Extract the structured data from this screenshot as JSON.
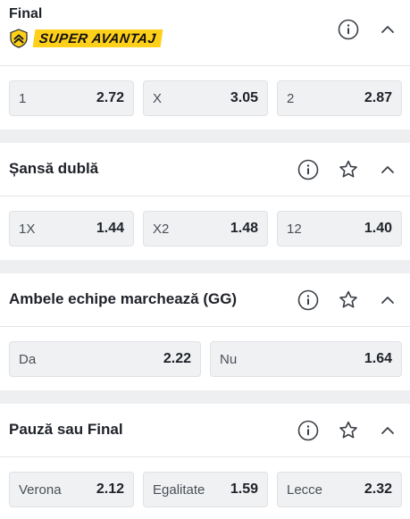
{
  "markets": [
    {
      "title": "Final",
      "badge": "SUPER AVANTAJ",
      "collapse_icon": "chevron-up-icon",
      "info_icon": "info-icon",
      "outcomes": [
        {
          "label": "1",
          "odds": "2.72"
        },
        {
          "label": "X",
          "odds": "3.05"
        },
        {
          "label": "2",
          "odds": "2.87"
        }
      ]
    },
    {
      "title": "Șansă dublă",
      "collapse_icon": "chevron-up-icon",
      "info_icon": "info-icon",
      "favorite_icon": "star-icon",
      "outcomes": [
        {
          "label": "1X",
          "odds": "1.44"
        },
        {
          "label": "X2",
          "odds": "1.48"
        },
        {
          "label": "12",
          "odds": "1.40"
        }
      ]
    },
    {
      "title": "Ambele echipe marchează (GG)",
      "collapse_icon": "chevron-up-icon",
      "info_icon": "info-icon",
      "favorite_icon": "star-icon",
      "outcomes": [
        {
          "label": "Da",
          "odds": "2.22"
        },
        {
          "label": "Nu",
          "odds": "1.64"
        }
      ]
    },
    {
      "title": "Pauză sau Final",
      "collapse_icon": "chevron-up-icon",
      "info_icon": "info-icon",
      "favorite_icon": "star-icon",
      "outcomes": [
        {
          "label": "Verona",
          "odds": "2.12"
        },
        {
          "label": "Egalitate",
          "odds": "1.59"
        },
        {
          "label": "Lecce",
          "odds": "2.32"
        }
      ]
    }
  ],
  "colors": {
    "page_background": "#eeeff1",
    "card_background": "#ffffff",
    "outcome_background": "#f0f1f3",
    "badge_yellow": "#ffd01a",
    "text": "#1e2228"
  }
}
